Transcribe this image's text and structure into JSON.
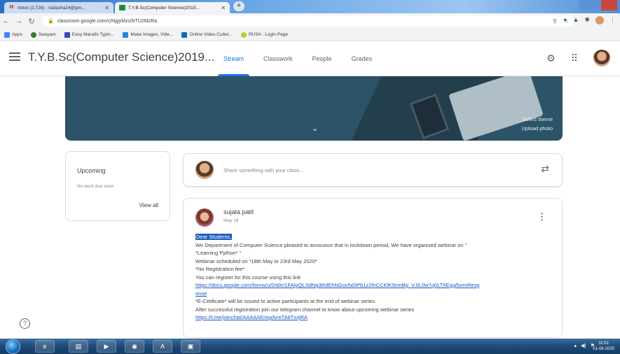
{
  "browser": {
    "tabs": [
      {
        "title": "Inbox (2,728) - nailasha24@gm...",
        "favicon": "gmail-icon",
        "active": false
      },
      {
        "title": "T.Y.B.Sc(Computer Science)2019...",
        "favicon": "classroom-icon",
        "active": true
      }
    ],
    "new_tab_symbol": "+",
    "url": "classroom.google.com/c/NjgyMzciNTU2MzRa",
    "bookmarks": [
      {
        "label": "Apps",
        "icon": "apps-grid-icon",
        "color": "#4285f4"
      },
      {
        "label": "Swayam",
        "icon": "swayam-icon",
        "color": "#2e7d32"
      },
      {
        "label": "Easy Marathi Typin...",
        "icon": "marathi-typing-icon",
        "color": "#3949ab"
      },
      {
        "label": "Make Images, Vide...",
        "icon": "make-images-icon",
        "color": "#1e88e5"
      },
      {
        "label": "Online Video Cutter...",
        "icon": "video-cutter-icon",
        "color": "#1565c0"
      },
      {
        "label": "RUSA : Login Page",
        "icon": "rusa-icon",
        "color": "#c0ca33"
      }
    ]
  },
  "classroom": {
    "class_title": "T.Y.B.Sc(Computer Science)2019...",
    "nav_tabs": [
      "Stream",
      "Classwork",
      "People",
      "Grades"
    ],
    "active_tab": "Stream",
    "banner": {
      "select_theme": "Select theme",
      "upload_photo": "Upload photo"
    },
    "upcoming": {
      "heading": "Upcoming",
      "subtitle": "No work due soon",
      "view_all": "View all"
    },
    "share_placeholder": "Share something with your class...",
    "post": {
      "author": "sujata patil",
      "date": "May 16",
      "lines": [
        {
          "text": "Dear Students,",
          "style": "highlight"
        },
        {
          "text": "We Department of Computer Science pleased to announce that in lockdown period, We have organized webinar on \"",
          "style": "normal"
        },
        {
          "text": "*Learning Python* \"",
          "style": "normal"
        },
        {
          "text": "Webinar scheduled on *18th May to 23rd May 2020*",
          "style": "normal"
        },
        {
          "text": " *No Registration fee*",
          "style": "normal"
        },
        {
          "text": "You can register for this course using this link",
          "style": "normal"
        },
        {
          "text": "https://docs.google.com/forms/u/0/d/e/1FAIpQLSdNg3RdEhNGov5d3Pb1z2fnCCKfK9zmBg_VJIL0w7q0LThEgg/formResp",
          "style": "link"
        },
        {
          "text": "onse",
          "style": "link"
        },
        {
          "text": " *E-Cetificate* will be issued to active participants at the end of webinar series.",
          "style": "normal"
        },
        {
          "text": "After successful registration join our telegram channel to know about upcoming webinar series",
          "style": "normal"
        },
        {
          "text": "https://t.me/joinchat/AAAAAEregdvreTA8TxxjRA",
          "style": "link"
        }
      ]
    }
  },
  "taskbar": {
    "apps": [
      "ie-icon",
      "file-explorer-icon",
      "media-player-icon",
      "chrome-icon",
      "acrobat-icon",
      "app-window-icon"
    ],
    "time": "11:51",
    "date": "01-06-2020"
  }
}
